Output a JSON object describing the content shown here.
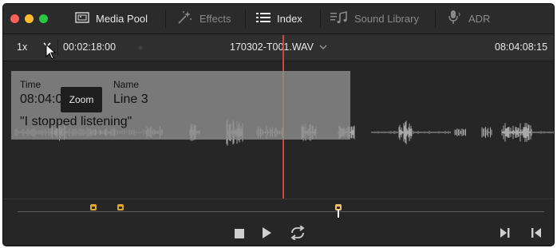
{
  "window": {
    "traffic_lights": [
      "#fe5f57",
      "#febc2e",
      "#28c840"
    ]
  },
  "tabs": [
    {
      "label": "Media Pool",
      "icon": "media-pool-icon",
      "active": true
    },
    {
      "label": "Effects",
      "icon": "effects-wand-icon",
      "active": false
    },
    {
      "label": "Index",
      "icon": "index-list-icon",
      "active": true
    },
    {
      "label": "Sound Library",
      "icon": "sound-library-icon",
      "active": false
    },
    {
      "label": "ADR",
      "icon": "microphone-icon",
      "active": false
    }
  ],
  "toolbar": {
    "zoom_value": "1x",
    "duration": "00:02:18:00",
    "clip_name": "170302-T001.WAV",
    "timecode": "08:04:08:15"
  },
  "overlay": {
    "time_label": "Time",
    "time_value": "08:04:08:15",
    "name_label": "Name",
    "name_value": "Line 3",
    "quote": "\"I stopped listening\""
  },
  "tooltip": {
    "text": "Zoom"
  },
  "colors": {
    "accent": "#e0a52e",
    "playhead": "#c94a3c",
    "background": "#232323"
  }
}
